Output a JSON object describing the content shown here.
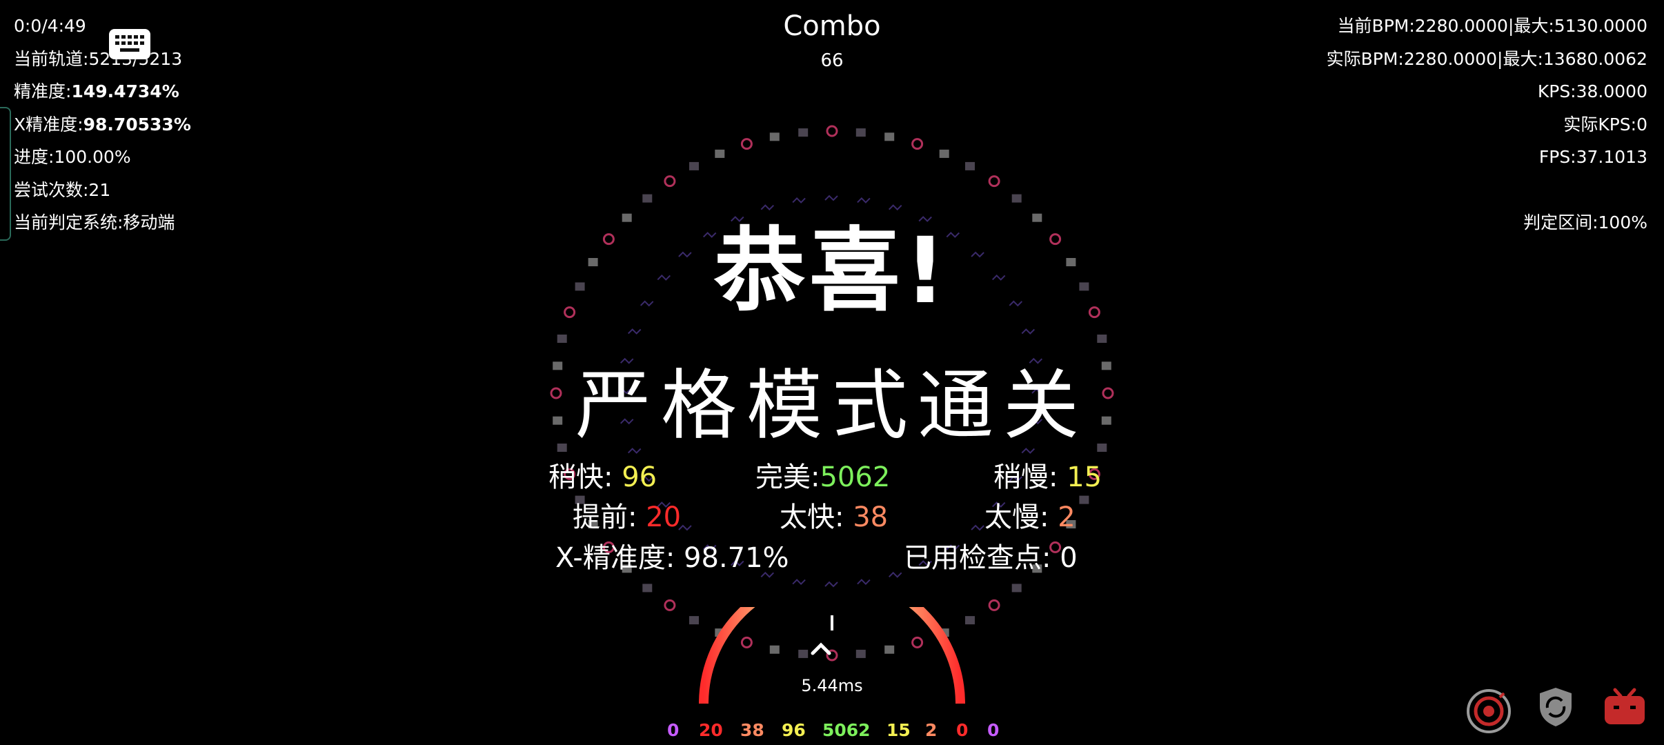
{
  "hud_left": {
    "time": "0:0/4:49",
    "track_label": "当前轨道:",
    "track_value": "5213/5213",
    "accuracy_label": "精准度:",
    "accuracy_value": "149.4734%",
    "x_accuracy_label": "X精准度:",
    "x_accuracy_value": "98.70533%",
    "progress": "进度:100.00%",
    "attempts": "尝试次数:21",
    "judge_system": "当前判定系统:移动端"
  },
  "hud_right": {
    "bpm": "当前BPM:2280.0000|最大:5130.0000",
    "actual_bpm": "实际BPM:2280.0000|最大:13680.0062",
    "kps": "KPS:38.0000",
    "actual_kps": "实际KPS:0",
    "fps": "FPS:37.1013",
    "judge_window": "判定区间:100%"
  },
  "combo": {
    "label": "Combo",
    "value": "66"
  },
  "result": {
    "congrats": "恭喜!",
    "mode_clear": "严格模式通关",
    "slightly_early_label": "稍快:",
    "slightly_early_value": "96",
    "perfect_label": "完美:",
    "perfect_value": "5062",
    "slightly_late_label": "稍慢:",
    "slightly_late_value": "15",
    "early_label": "提前:",
    "early_value": "20",
    "too_early_label": "太快:",
    "too_early_value": "38",
    "too_late_label": "太慢:",
    "too_late_value": "2",
    "x_accuracy_label": "X-精准度:",
    "x_accuracy_value": "98.71%",
    "checkpoints_label": "已用检查点:",
    "checkpoints_value": "0"
  },
  "gauge": {
    "ms": "5.44ms"
  },
  "bottom_counts": [
    "0",
    "20",
    "38",
    "96",
    "5062",
    "15",
    "2",
    "0",
    "0"
  ],
  "colors": {
    "yellow": "#f3ef52",
    "green": "#7df05c",
    "red": "#ff2b2b",
    "salmon": "#ff8a62",
    "purple": "#c65cff",
    "icon_red": "#c42a2a",
    "icon_grey": "#9a9a9a"
  },
  "icons": [
    "keyboard-icon",
    "target-icon",
    "shield-icon",
    "tv-icon"
  ]
}
